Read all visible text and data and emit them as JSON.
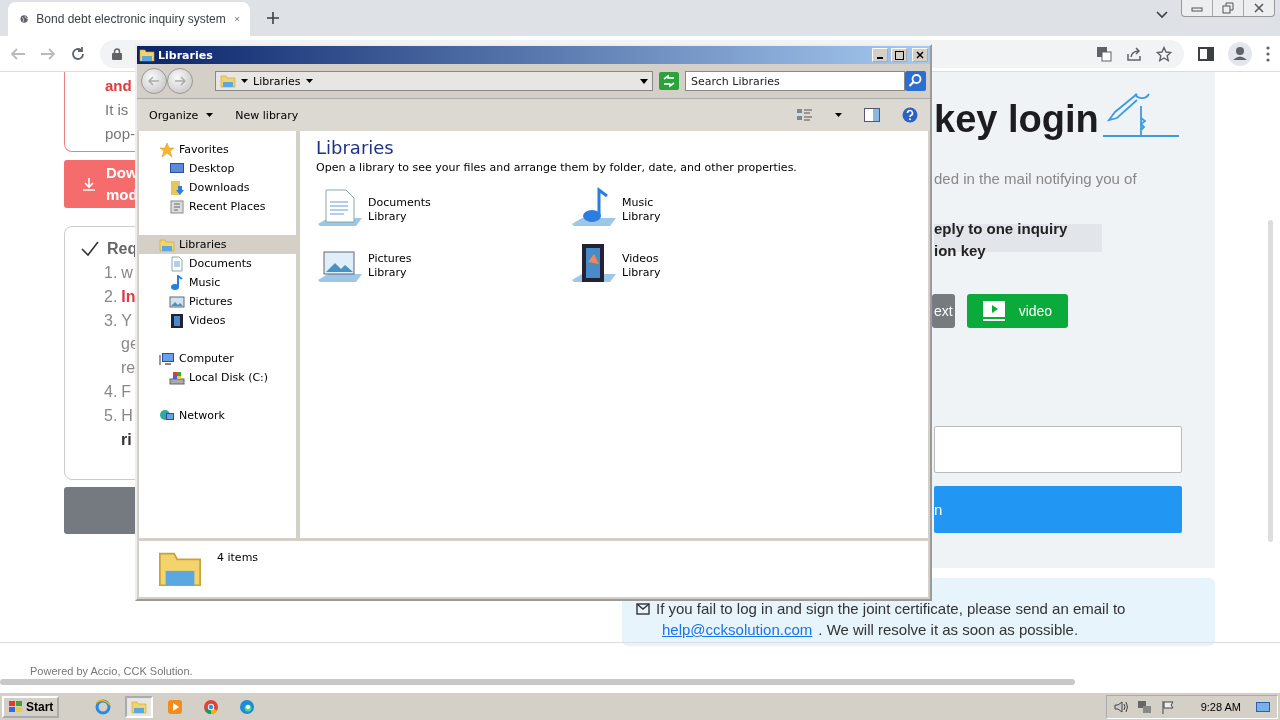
{
  "browser": {
    "tab": {
      "title": "Bond debt electronic inquiry system"
    }
  },
  "page": {
    "notice_card": {
      "lines": [
        {
          "text": "and",
          "kind": "red"
        },
        {
          "text": "It is",
          "kind": "normal"
        },
        {
          "text": "pop-",
          "kind": "normal"
        }
      ]
    },
    "download_button": {
      "lines": [
        "Dow",
        "mod"
      ]
    },
    "requirements": {
      "title": "Req",
      "items": [
        {
          "number": "1.",
          "text": "w",
          "kind": "normal"
        },
        {
          "number": "2.",
          "text": "In",
          "kind": "red"
        },
        {
          "number": "3.",
          "text": "Y",
          "kind": "normal"
        },
        {
          "text": "ge",
          "kind": "normal"
        },
        {
          "text": "re",
          "kind": "normal"
        },
        {
          "number": "4.",
          "text": "F",
          "kind": "normal"
        },
        {
          "number": "5.",
          "text": "H",
          "kind": "normal"
        },
        {
          "text": "ri",
          "kind": "bold"
        }
      ]
    },
    "login_panel": {
      "title": "key login",
      "description": "ded in the mail notifying you of",
      "notice_lines": [
        "eply to one inquiry",
        "ion key"
      ],
      "buttons": [
        {
          "label": "ext",
          "kind": "secondary"
        },
        {
          "label": "video",
          "kind": "video"
        }
      ],
      "submit": "n"
    },
    "help_box": {
      "text": "If you fail to log in and sign the joint certificate, please send an email to",
      "link": "help@ccksolution.com",
      "after": ". We will resolve it as soon as possible."
    },
    "footer": "Powered by Accio, CCK Solution."
  },
  "explorer": {
    "title": "Libraries",
    "address": "Libraries",
    "search": {
      "placeholder": "Search Libraries"
    },
    "commands": [
      "Organize",
      "New library"
    ],
    "navigation": [
      {
        "label": "Favorites",
        "kind": "star",
        "selected": false,
        "children": [
          {
            "label": "Desktop",
            "kind": "desktop",
            "selected": false
          },
          {
            "label": "Downloads",
            "kind": "downloads",
            "selected": false
          },
          {
            "label": "Recent Places",
            "kind": "recent",
            "selected": false
          }
        ]
      },
      {
        "label": "Libraries",
        "kind": "library",
        "selected": true,
        "children": [
          {
            "label": "Documents",
            "kind": "documents",
            "selected": false
          },
          {
            "label": "Music",
            "kind": "music",
            "selected": false
          },
          {
            "label": "Pictures",
            "kind": "pictures",
            "selected": false
          },
          {
            "label": "Videos",
            "kind": "videos",
            "selected": false
          }
        ]
      },
      {
        "label": "Computer",
        "kind": "computer",
        "selected": false,
        "children": [
          {
            "label": "Local Disk (C:)",
            "kind": "disk",
            "selected": false
          }
        ]
      },
      {
        "label": "Network",
        "kind": "network",
        "selected": false
      }
    ],
    "heading": "Libraries",
    "description": "Open a library to see your files and arrange them by folder, date, and other properties.",
    "items": [
      {
        "name": "Documents",
        "subtitle": "Library",
        "kind": "documents"
      },
      {
        "name": "Music",
        "subtitle": "Library",
        "kind": "music"
      },
      {
        "name": "Pictures",
        "subtitle": "Library",
        "kind": "pictures"
      },
      {
        "name": "Videos",
        "subtitle": "Library",
        "kind": "videos"
      }
    ],
    "status": "4 items"
  },
  "taskbar": {
    "start": "Start",
    "apps": [
      {
        "kind": "ie",
        "selected": false
      },
      {
        "kind": "explorer",
        "selected": true
      },
      {
        "kind": "media",
        "selected": false
      },
      {
        "kind": "chrome",
        "selected": false
      },
      {
        "kind": "edge",
        "selected": false
      }
    ],
    "clock": "9:28 AM"
  }
}
